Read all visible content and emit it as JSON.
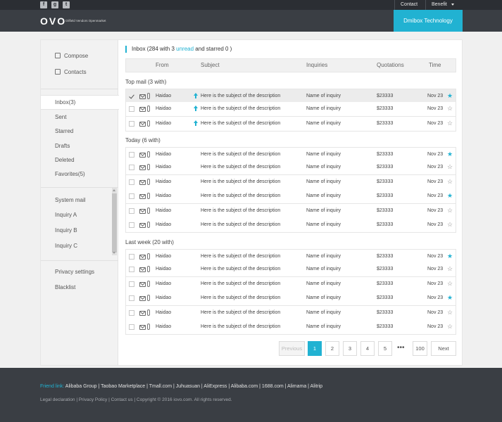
{
  "topbar": {
    "social": [
      "facebook-icon",
      "google-plus-icon",
      "twitter-icon"
    ],
    "contact": "Contact",
    "benefit": "Benefit"
  },
  "header": {
    "logo": "OVO",
    "tagline": "Oilfield Vendors Openmarket",
    "brand": "Dmibox Technology"
  },
  "sidebar": {
    "compose": "Compose",
    "contacts": "Contacts",
    "folders": [
      "Inbox(3)",
      "Sent",
      "Starred",
      "Drafts",
      "Deleted",
      "Favorites(5)"
    ],
    "categories": [
      "System mail",
      "Inquiry A",
      "Inquiry B",
      "Inquiry C"
    ],
    "settings": [
      "Privacy settings",
      "Blacklist"
    ]
  },
  "inbox": {
    "title_prefix": "Inbox (284 with 3 ",
    "title_unread": "unread",
    "title_suffix": " and starred 0 )"
  },
  "columns": {
    "from": "From",
    "subject": "Subject",
    "inquiries": "Inquiries",
    "quotations": "Quotations",
    "time": "Time"
  },
  "sections": [
    {
      "title": "Top mail (3 with)",
      "rows": [
        {
          "from": "Haidao",
          "subject": "Here is the subject of the description",
          "inquiry": "Name of inquiry",
          "quote": "$23333",
          "time": "Nov 23",
          "starred": true,
          "checked": true,
          "top": true
        },
        {
          "from": "Haidao",
          "subject": "Here is the subject of the description",
          "inquiry": "Name of inquiry",
          "quote": "$23333",
          "time": "Nov 23",
          "starred": false,
          "checked": false,
          "top": true
        },
        {
          "from": "Haidao",
          "subject": "Here is the subject of the description",
          "inquiry": "Name of inquiry",
          "quote": "$23333",
          "time": "Nov 23",
          "starred": false,
          "checked": false,
          "top": true
        }
      ]
    },
    {
      "title": "Today (6 with)",
      "rows": [
        {
          "from": "Haidao",
          "subject": "Here is the subject of the description",
          "inquiry": "Name of inquiry",
          "quote": "$23333",
          "time": "Nov 23",
          "starred": true,
          "checked": false,
          "top": false
        },
        {
          "from": "Haidao",
          "subject": "Here is the subject of the description",
          "inquiry": "Name of inquiry",
          "quote": "$23333",
          "time": "Nov 23",
          "starred": false,
          "checked": false,
          "top": false
        },
        {
          "from": "Haidao",
          "subject": "Here is the subject of the description",
          "inquiry": "Name of inquiry",
          "quote": "$23333",
          "time": "Nov 23",
          "starred": false,
          "checked": false,
          "top": false
        },
        {
          "from": "Haidao",
          "subject": "Here is the subject of the description",
          "inquiry": "Name of inquiry",
          "quote": "$23333",
          "time": "Nov 23",
          "starred": true,
          "checked": false,
          "top": false
        },
        {
          "from": "Haidao",
          "subject": "Here is the subject of the description",
          "inquiry": "Name of inquiry",
          "quote": "$23333",
          "time": "Nov 23",
          "starred": false,
          "checked": false,
          "top": false
        },
        {
          "from": "Haidao",
          "subject": "Here is the subject of the description",
          "inquiry": "Name of inquiry",
          "quote": "$23333",
          "time": "Nov 23",
          "starred": false,
          "checked": false,
          "top": false
        }
      ]
    },
    {
      "title": "Last week (20 with)",
      "rows": [
        {
          "from": "Haidao",
          "subject": "Here is the subject of the description",
          "inquiry": "Name of inquiry",
          "quote": "$23333",
          "time": "Nov 23",
          "starred": true,
          "checked": false,
          "top": false
        },
        {
          "from": "Haidao",
          "subject": "Here is the subject of the description",
          "inquiry": "Name of inquiry",
          "quote": "$23333",
          "time": "Nov 23",
          "starred": false,
          "checked": false,
          "top": false
        },
        {
          "from": "Haidao",
          "subject": "Here is the subject of the description",
          "inquiry": "Name of inquiry",
          "quote": "$23333",
          "time": "Nov 23",
          "starred": false,
          "checked": false,
          "top": false
        },
        {
          "from": "Haidao",
          "subject": "Here is the subject of the description",
          "inquiry": "Name of inquiry",
          "quote": "$23333",
          "time": "Nov 23",
          "starred": true,
          "checked": false,
          "top": false
        },
        {
          "from": "Haidao",
          "subject": "Here is the subject of the description",
          "inquiry": "Name of inquiry",
          "quote": "$23333",
          "time": "Nov 23",
          "starred": false,
          "checked": false,
          "top": false
        },
        {
          "from": "Haidao",
          "subject": "Here is the subject of the description",
          "inquiry": "Name of inquiry",
          "quote": "$23333",
          "time": "Nov 23",
          "starred": false,
          "checked": false,
          "top": false
        }
      ]
    }
  ],
  "pagination": {
    "previous": "Previous",
    "pages": [
      "1",
      "2",
      "3",
      "4",
      "5"
    ],
    "current": "1",
    "ellipsis": "•••",
    "last": "100",
    "next": "Next"
  },
  "footer": {
    "friend_label": "Friend link:",
    "links": "Alibaba Group | Taobao Marketplace | Tmall.com | Juhuasuan | AliExpress | Alibaba.com | 1688.com | Alimama | Alitrip",
    "legal": "Legal declaration | Privacy Policy | Contact us |  Copyright © 2016 iovo.com. All rights reserved."
  },
  "colors": {
    "accent": "#21b2d2",
    "topbar": "#2b2e33",
    "header": "#3a3e44"
  }
}
